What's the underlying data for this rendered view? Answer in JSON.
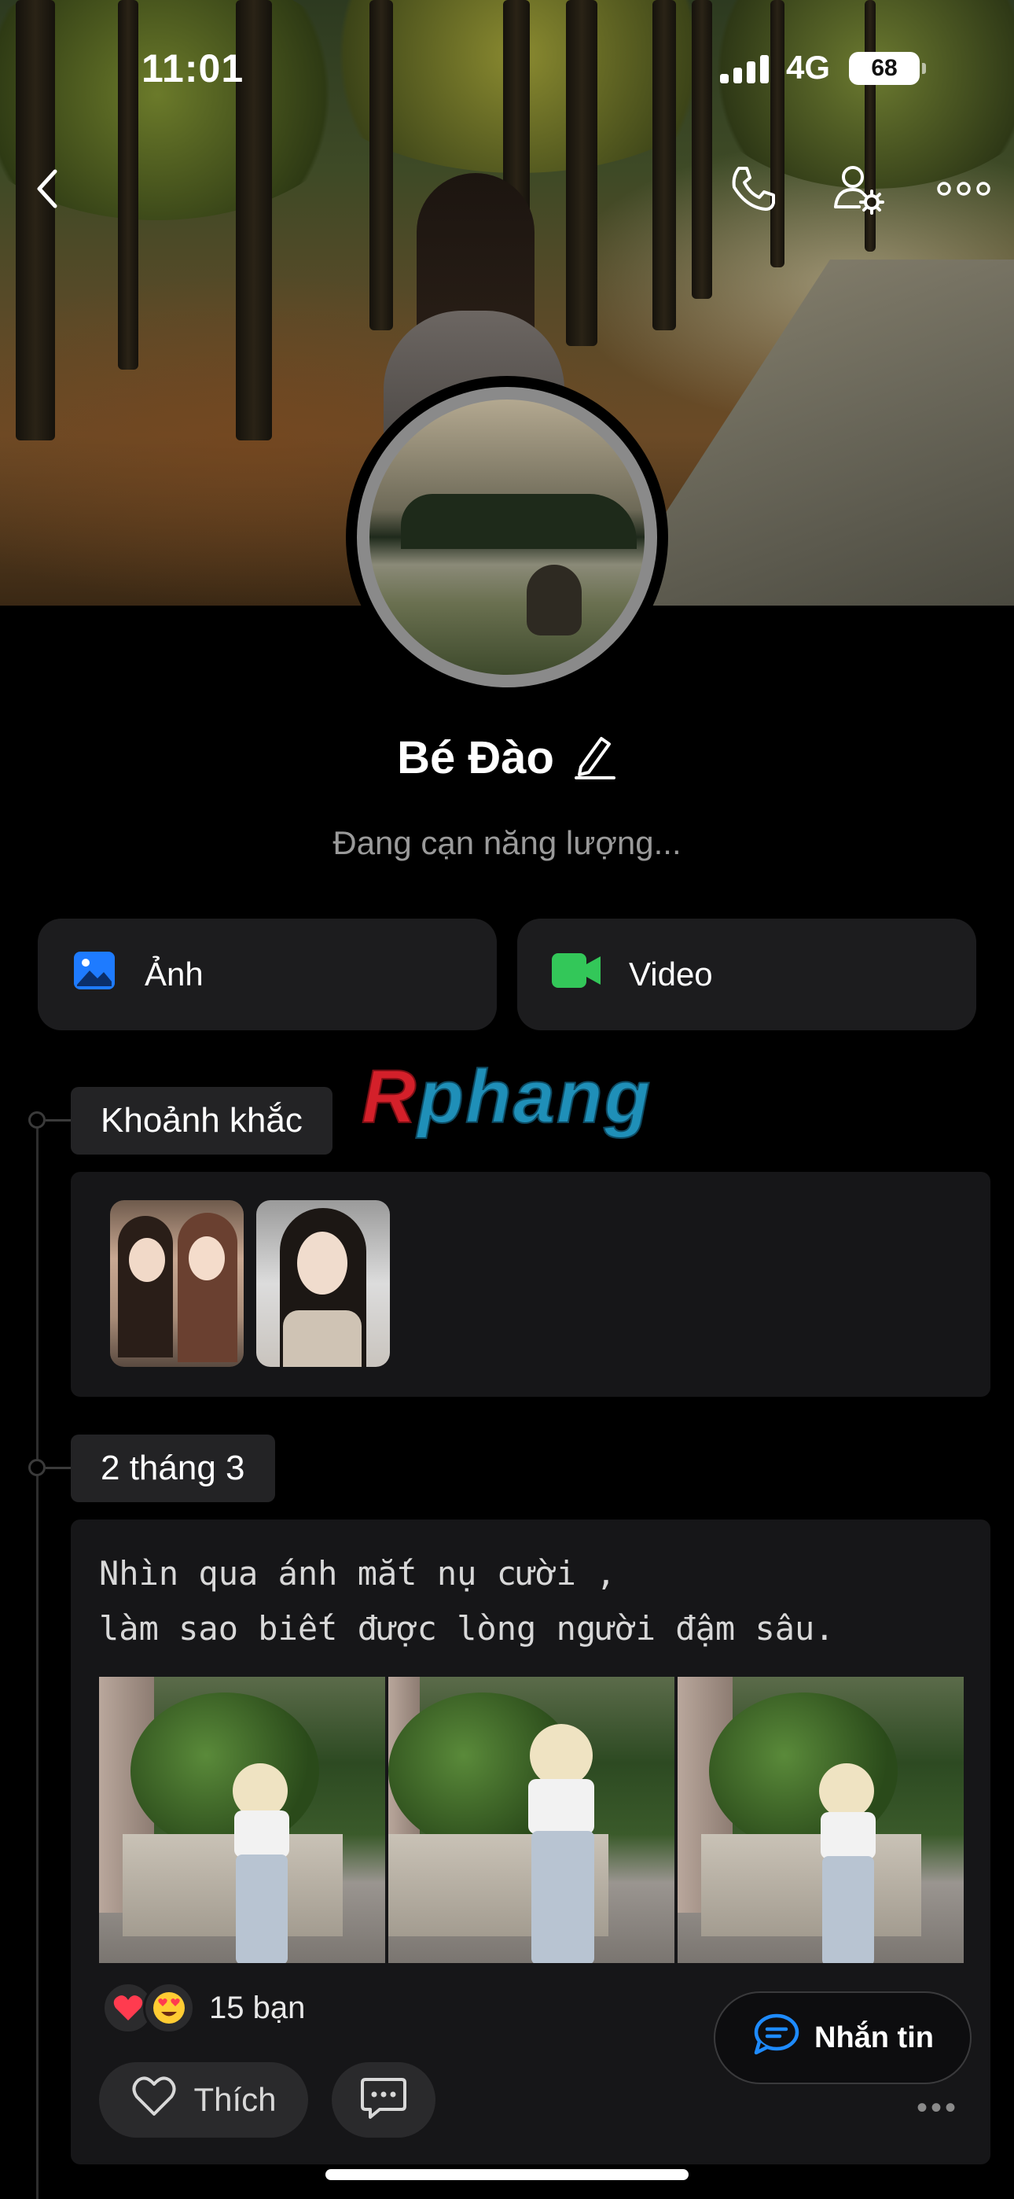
{
  "status_bar": {
    "time": "11:01",
    "network": "4G",
    "battery": "68"
  },
  "header": {
    "icons": [
      "back-chevron-icon",
      "phone-icon",
      "user-settings-icon",
      "more-icon"
    ]
  },
  "profile": {
    "name": "Bé Đào",
    "bio": "Đang cạn năng lượng..."
  },
  "actions": {
    "photo_label": "Ảnh",
    "video_label": "Video",
    "photo_icon_color": "#1e7bff",
    "video_icon_color": "#33c759"
  },
  "watermark": {
    "first": "R",
    "rest": "phang"
  },
  "moments": {
    "title": "Khoảnh khắc",
    "count": 2
  },
  "post": {
    "date": "2 tháng 3",
    "text_line1": "Nhìn qua ánh mắt nụ cười ,",
    "text_line2": "làm sao biết được lòng người đậm sâu.",
    "photo_count": 3,
    "reactions": [
      "heart",
      "heart-eyes"
    ],
    "reaction_count": "15 bạn",
    "like_label": "Thích"
  },
  "message_button": {
    "label": "Nhắn tin",
    "accent": "#1e8bff"
  }
}
